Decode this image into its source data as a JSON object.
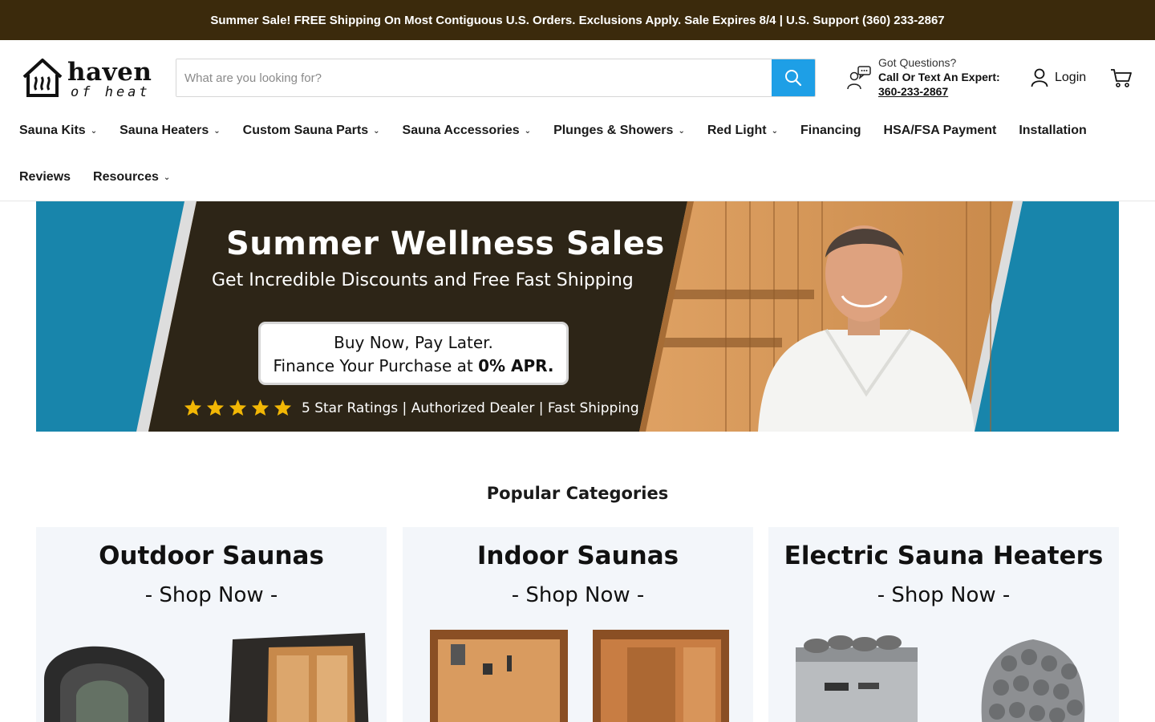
{
  "announcement": "Summer Sale! FREE Shipping On Most Contiguous U.S. Orders. Exclusions Apply. Sale Expires 8/4 | U.S. Support (360) 233-2867",
  "logo": {
    "name": "haven",
    "tagline": "of heat"
  },
  "search": {
    "placeholder": "What are you looking for?",
    "icon": "search-icon"
  },
  "expert": {
    "line1": "Got Questions?",
    "line2": "Call Or Text An Expert:",
    "phone": "360-233-2867",
    "icon": "chat-support-icon"
  },
  "account": {
    "login_label": "Login",
    "cart_icon": "cart-icon"
  },
  "nav": {
    "row1": [
      {
        "label": "Sauna Kits",
        "dropdown": true
      },
      {
        "label": "Sauna Heaters",
        "dropdown": true
      },
      {
        "label": "Custom Sauna Parts",
        "dropdown": true
      },
      {
        "label": "Sauna Accessories",
        "dropdown": true
      },
      {
        "label": "Plunges & Showers",
        "dropdown": true
      },
      {
        "label": "Red Light",
        "dropdown": true
      },
      {
        "label": "Financing",
        "dropdown": false
      },
      {
        "label": "HSA/FSA Payment",
        "dropdown": false
      },
      {
        "label": "Installation",
        "dropdown": false
      }
    ],
    "row2": [
      {
        "label": "Reviews",
        "dropdown": false
      },
      {
        "label": "Resources",
        "dropdown": true
      }
    ]
  },
  "hero": {
    "title": "Summer Wellness Sales",
    "subtitle": "Get Incredible Discounts and Free Fast Shipping",
    "finance_line1": "Buy Now, Pay Later.",
    "finance_line2_prefix": "Finance Your Purchase at ",
    "finance_line2_bold": "0% APR.",
    "rating_stars": 5,
    "trust_text": "5 Star Ratings | Authorized Dealer | Fast Shipping"
  },
  "popular": {
    "title": "Popular Categories",
    "cards": [
      {
        "title": "Outdoor Saunas",
        "cta": "- Shop Now -"
      },
      {
        "title": "Indoor Saunas",
        "cta": "- Shop Now -"
      },
      {
        "title": "Electric Sauna Heaters",
        "cta": "- Shop Now -"
      }
    ]
  },
  "colors": {
    "announcement_bg": "#3b2a0c",
    "search_button": "#1e9fe6",
    "hero_blue": "#1885ab",
    "hero_dark": "#2d2517",
    "star": "#f2b705",
    "card_bg": "#f3f6fa"
  }
}
